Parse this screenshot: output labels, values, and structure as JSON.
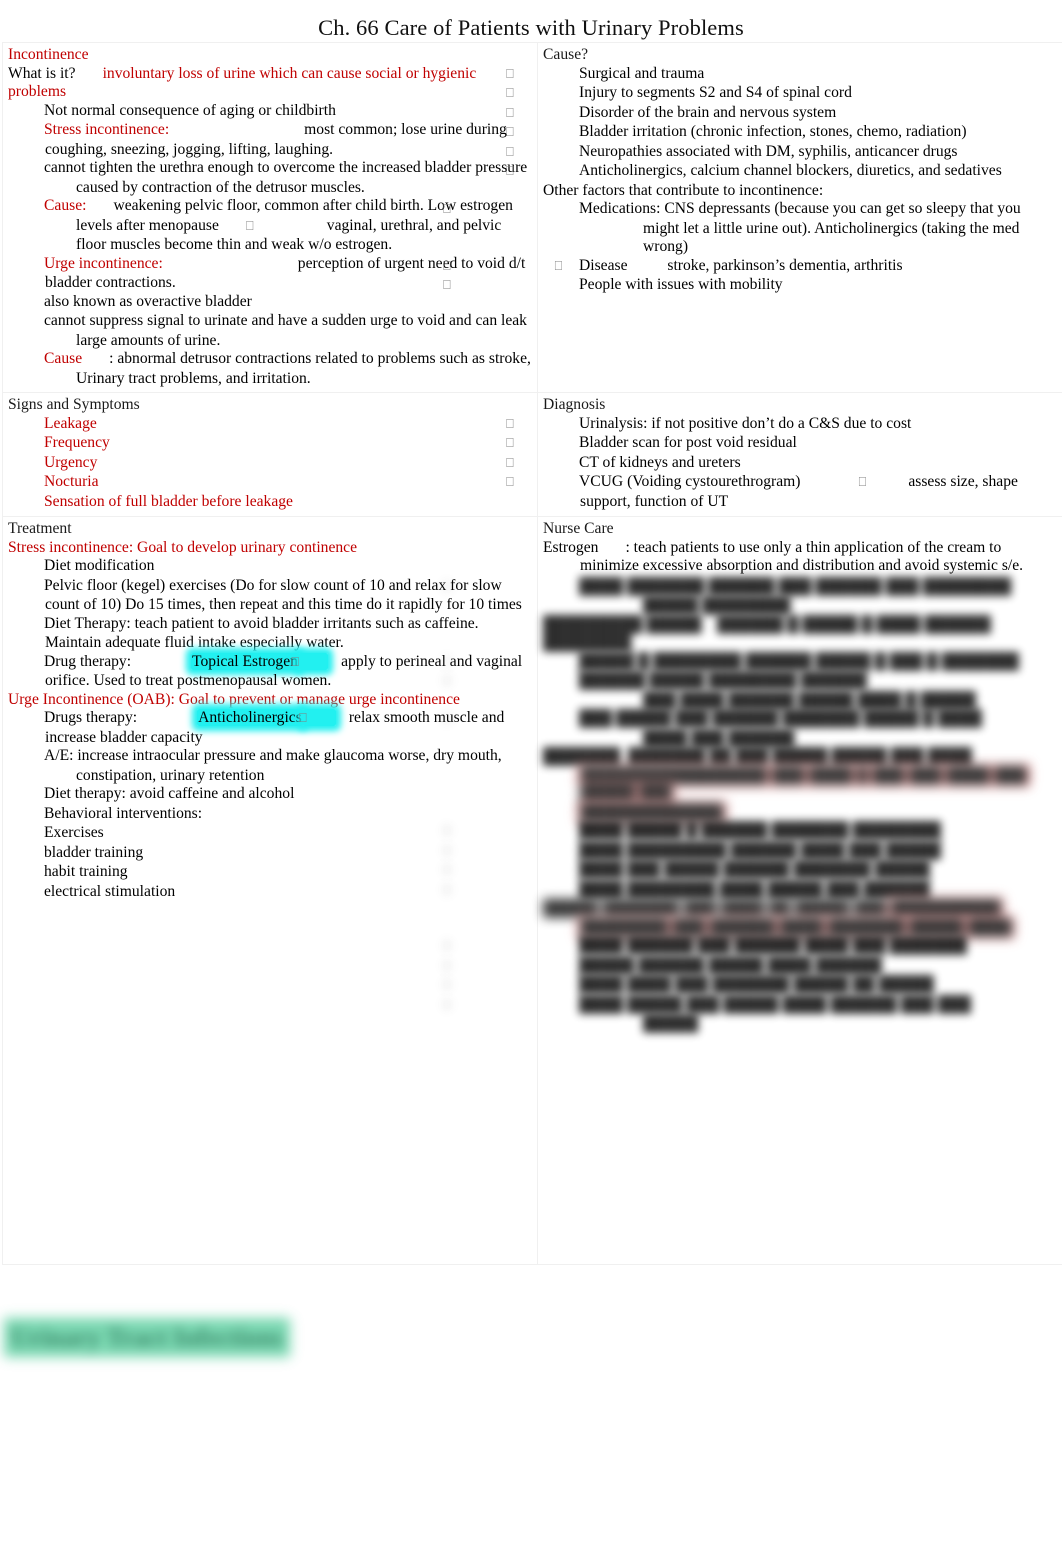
{
  "document": {
    "title": "Ch. 66 Care of Patients with Urinary Problems"
  },
  "colors": {
    "accent_red": "#C00000",
    "highlight_cyan": "#22F0F0",
    "highlight_green": "#63D1A4",
    "highlight_pink": "#FF9A9A",
    "text": "#000000"
  },
  "sections": {
    "incontinence": {
      "heading": "Incontinence",
      "what_label": "What is it?",
      "what_answer": "involuntary loss of urine which can cause social or hygienic problems",
      "b1": "Not normal consequence of aging or childbirth",
      "stress_label": "Stress incontinence:",
      "stress_text": "most common; lose urine during coughing, sneezing, jogging, lifting, laughing.",
      "stress_sub1": "cannot tighten the urethra enough to overcome the increased bladder pressure caused by contraction of the detrusor muscles.",
      "stress_cause_label": "Cause:",
      "stress_cause_a": "weakening pelvic floor, common after child birth. Low estrogen levels after menopause",
      "stress_cause_b": "vaginal, urethral, and pelvic floor muscles become thin and weak w/o estrogen.",
      "urge_label": "Urge incontinence:",
      "urge_text": "perception of urgent need to void d/t bladder contractions.",
      "urge_sub1": "also known as overactive bladder",
      "urge_sub2": "cannot suppress signal to urinate and have a sudden urge to void and can leak large amounts of urine.",
      "urge_cause_label": "Cause",
      "urge_cause_text": ": abnormal detrusor contractions related to problems such as stroke, Urinary tract problems, and irritation."
    },
    "cause": {
      "heading": "Cause?",
      "items": [
        "Surgical and trauma",
        "Injury to segments S2 and S4 of spinal cord",
        "Disorder of the brain and nervous system",
        "Bladder irritation (chronic infection, stones, chemo, radiation)",
        "Neuropathies associated with DM, syphilis, anticancer drugs",
        "Anticholinergics, calcium channel blockers, diuretics, and sedatives"
      ],
      "other_heading": "Other factors that contribute to incontinence:",
      "other_1": "Medications: CNS depressants (because you can get so sleepy that you might let a little urine out). Anticholinergics (taking the med wrong)",
      "other_2_a": "Disease",
      "other_2_b": "stroke, parkinson’s dementia, arthritis",
      "other_3": "People with issues with mobility"
    },
    "signs": {
      "heading": "Signs and Symptoms",
      "items": [
        "Leakage",
        "Frequency",
        "Urgency",
        "Nocturia",
        "Sensation of full bladder before leakage"
      ]
    },
    "diagnosis": {
      "heading": "Diagnosis",
      "items": [
        "Urinalysis: if not positive don’t do a C&S due to cost",
        "Bladder scan for post void residual",
        "CT of kidneys and ureters"
      ],
      "vcug_a": "VCUG (Voiding cystourethrogram)",
      "vcug_b": "assess size, shape support, function of UT"
    },
    "treatment": {
      "heading": "Treatment",
      "stress_goal": "Stress incontinence: Goal to develop urinary continence",
      "items": [
        "Diet modification",
        "Pelvic floor (kegel) exercises (Do for slow count of 10 and relax for slow count of 10) Do 15 times, then repeat and this time do it rapidly for 10 times",
        "Diet Therapy: teach patient to avoid bladder irritants such as caffeine. Maintain adequate fluid intake especially water."
      ],
      "drug_label": "Drug therapy:",
      "drug_highlight": "Topical Estrogen",
      "drug_text": "apply to perineal and vaginal orifice. Used to treat postmenopausal women.",
      "urge_goal": "Urge Incontinence (OAB): Goal to prevent or manage urge incontinence",
      "drugs_label": "Drugs therapy:",
      "drugs_highlight": "Anticholinergics",
      "drugs_text": "relax smooth muscle and increase bladder capacity",
      "drugs_ae": "A/E: increase intraocular pressure and make glaucoma worse, dry mouth, constipation, urinary retention",
      "diet_therapy": "Diet therapy: avoid caffeine and alcohol",
      "behavioral_label": "Behavioral interventions:",
      "behavioral_items": [
        "Exercises",
        "bladder training",
        "habit training",
        "electrical stimulation"
      ]
    },
    "nurse_care": {
      "heading": "Nurse Care",
      "estrogen_label": "Estrogen",
      "estrogen_text": ": teach patients to use only a thin application of the cream to minimize excessive absorption and distribution and avoid systemic s/e.",
      "obscured_note": "",
      "obscured_lines": [
        "                                                   ",
        "                              "
      ]
    },
    "bottom": {
      "title": "Urinary Tract Infections"
    }
  }
}
